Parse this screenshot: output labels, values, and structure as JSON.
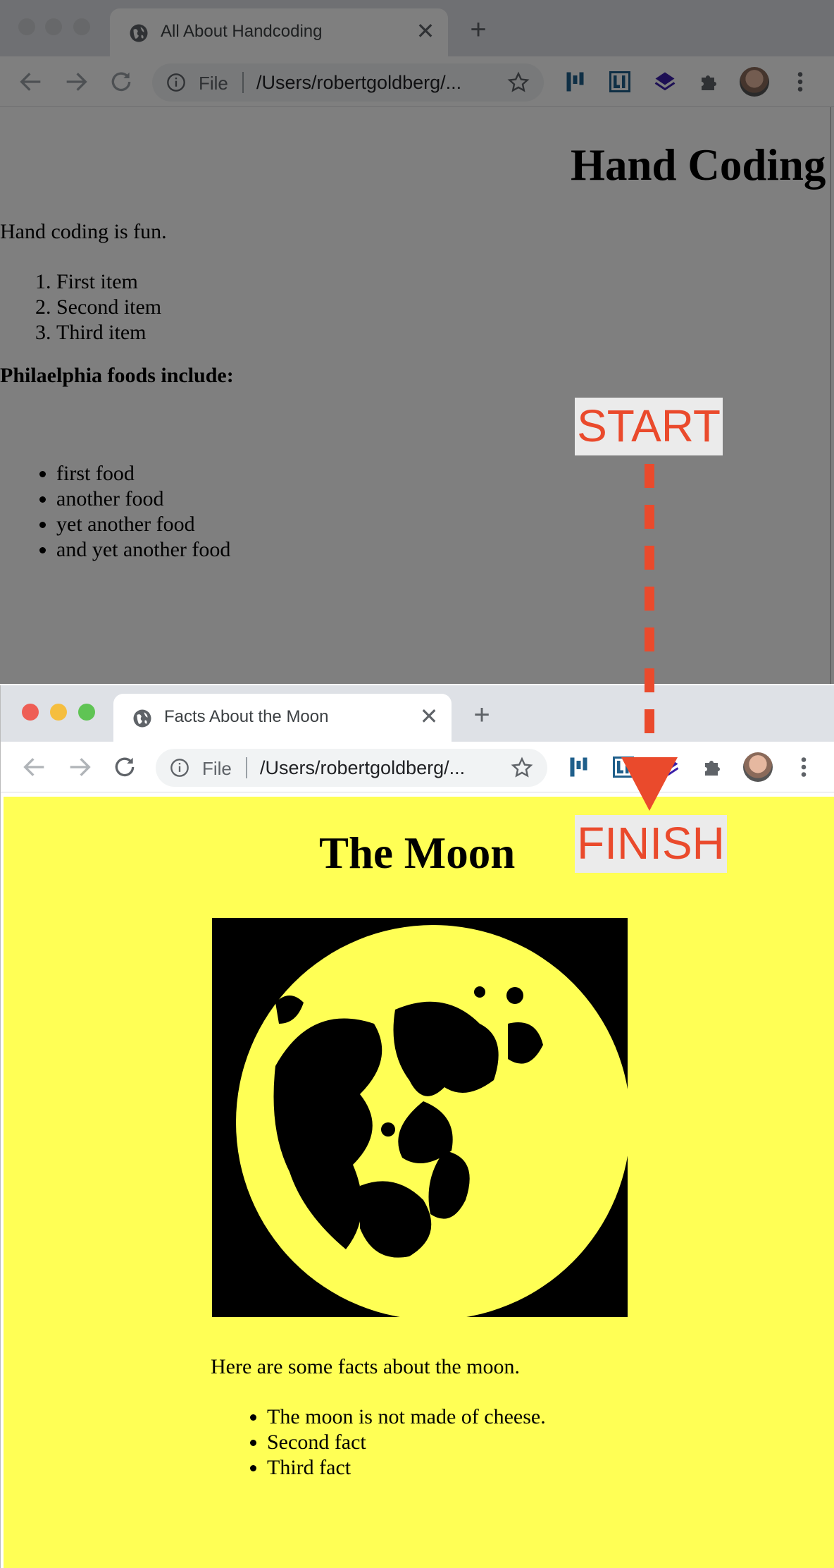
{
  "window1": {
    "tab_title": "All About Handcoding",
    "tab_close": "✕",
    "new_tab": "+",
    "omnibox": {
      "scheme": "File",
      "url": "/Users/robertgoldberg/..."
    },
    "page": {
      "heading": "Hand Coding",
      "intro": "Hand coding is fun.",
      "ordered_items": [
        "First item",
        "Second item",
        "Third item"
      ],
      "foods_heading": "Philaelphia foods include:",
      "food_items": [
        "first food",
        "another food",
        "yet another food",
        "and yet another food"
      ]
    }
  },
  "window2": {
    "tab_title": "Facts About the Moon",
    "tab_close": "✕",
    "new_tab": "+",
    "omnibox": {
      "scheme": "File",
      "url": "/Users/robertgoldberg/..."
    },
    "page": {
      "heading": "The Moon",
      "intro": "Here are some facts about the moon.",
      "facts": [
        "The moon is not made of cheese.",
        "Second fact",
        "Third fact"
      ]
    }
  },
  "annotation": {
    "start_label": "START",
    "finish_label": "FINISH",
    "accent_color": "#ea4a2c"
  },
  "colors": {
    "moon_page_background": "#ffff55",
    "tab_strip": "#dee1e6"
  },
  "icons": {
    "tab": "globe-icon",
    "nav": [
      "back-arrow-icon",
      "forward-arrow-icon",
      "reload-icon"
    ],
    "omnibox": [
      "info-icon",
      "star-icon"
    ],
    "extensions": [
      "blue-bars-extension-icon",
      "li-extension-icon",
      "purple-layers-extension-icon",
      "puzzle-icon"
    ],
    "menu": "kebab-menu-icon"
  }
}
